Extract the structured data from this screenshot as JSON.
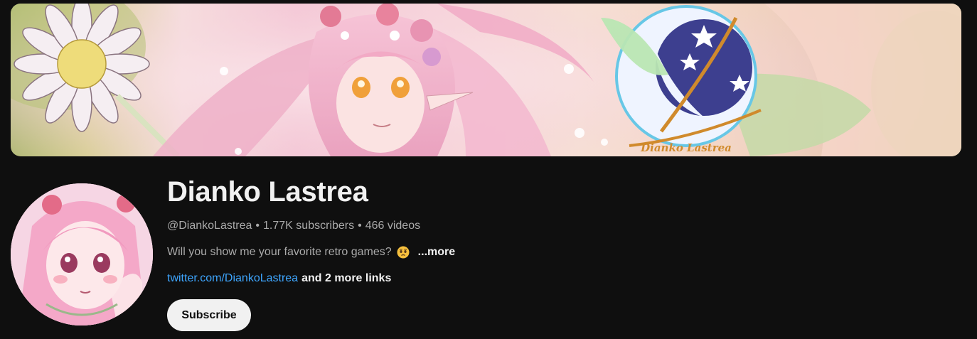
{
  "banner": {
    "logo_text": "Dianko Lastrea",
    "colors": {
      "pink": "#f4b8cf",
      "rose": "#e06f8f",
      "green": "#b9c77a",
      "navy": "#3d3f8f",
      "gold": "#d08a2c"
    }
  },
  "channel": {
    "name": "Dianko Lastrea",
    "handle": "@DiankoLastrea",
    "separator": "•",
    "subscribers": "1.77K subscribers",
    "videos": "466 videos",
    "description": "Will you show me your favorite retro games?",
    "description_emoji": "pleading-face-emoji",
    "more_label": "...more",
    "link": "twitter.com/DiankoLastrea",
    "more_links": "and 2 more links",
    "subscribe_label": "Subscribe"
  }
}
